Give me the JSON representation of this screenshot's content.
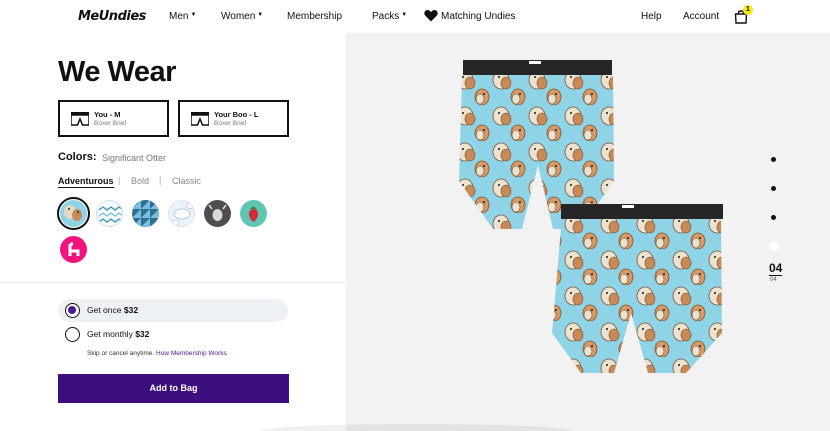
{
  "header": {
    "logo": "MeUndies",
    "nav": [
      "Men",
      "Women",
      "Membership",
      "Packs",
      "Matching Undies"
    ],
    "help": "Help",
    "account": "Account",
    "cart_count": "1"
  },
  "product": {
    "title": "We Wear",
    "people": [
      {
        "name": "You - M",
        "style": "Boxer Brief"
      },
      {
        "name": "Your Boo - L",
        "style": "Boxer Brief"
      }
    ],
    "colors_label": "Colors:",
    "color_selected": "Significant Otter",
    "tabs": [
      "Adventurous",
      "Bold",
      "Classic"
    ],
    "swatches": [
      {
        "name": "significant-otter",
        "color": "#8fd3e6"
      },
      {
        "name": "aztec-print",
        "color": "#dff3fa"
      },
      {
        "name": "geometric-triangles",
        "color": "#5fa7c8"
      },
      {
        "name": "clouds",
        "color": "#e8f2fb"
      },
      {
        "name": "goats",
        "color": "#555555"
      },
      {
        "name": "strawberry",
        "color": "#5fc6b4"
      },
      {
        "name": "llama",
        "color": "#f0137f"
      }
    ]
  },
  "purchase": {
    "once_label": "Get once",
    "once_price": "$32",
    "monthly_label": "Get monthly",
    "monthly_price": "$32",
    "fine_print": "Skip or cancel anytime.",
    "fine_link": "How Membership Works",
    "cta": "Add to Bag"
  },
  "gallery": {
    "current": "04",
    "total": "04"
  },
  "colors": {
    "accent": "#3d0e7d",
    "print_bg": "#8fd3e6",
    "badge": "#f6e716"
  }
}
